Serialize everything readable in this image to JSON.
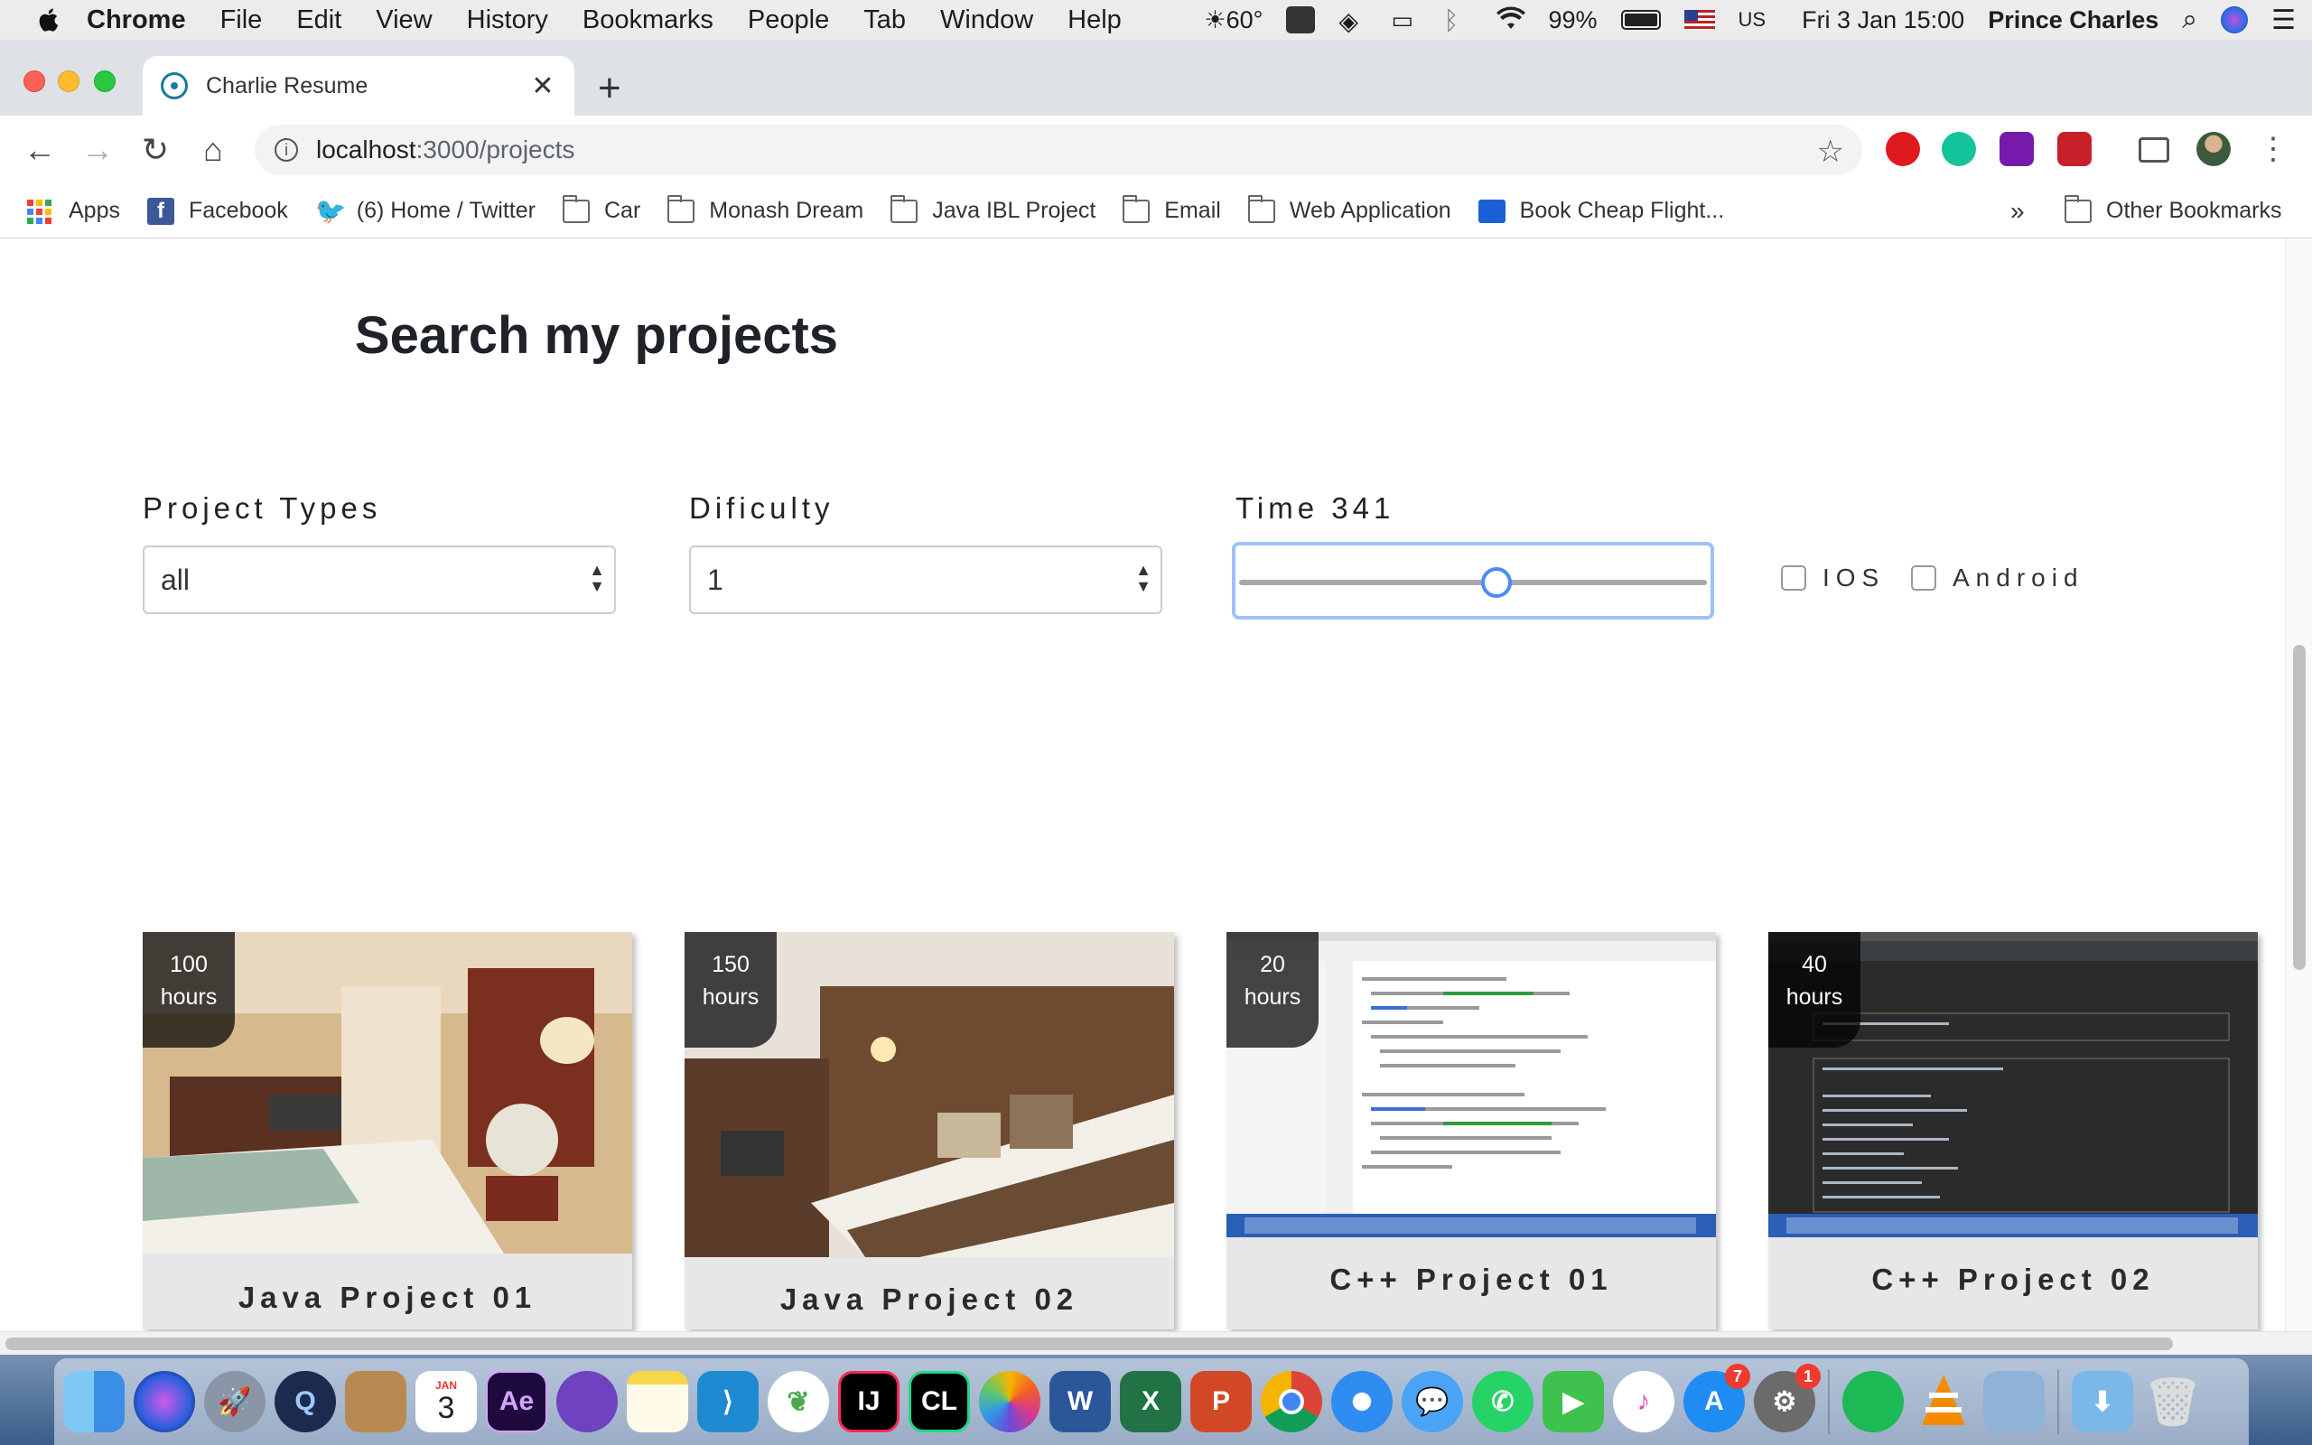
{
  "menubar": {
    "app": "Chrome",
    "items": [
      "File",
      "Edit",
      "View",
      "History",
      "Bookmarks",
      "People",
      "Tab",
      "Window",
      "Help"
    ],
    "temperature": "60°",
    "battery": "99%",
    "input_source": "US",
    "datetime": "Fri 3 Jan  15:00",
    "user": "Prince Charles"
  },
  "browser": {
    "tab_title": "Charlie Resume",
    "tab_close": "✕",
    "new_tab": "+",
    "url_host": "localhost",
    "url_path": ":3000/projects",
    "bookmarks": [
      {
        "label": "Apps",
        "icon": "apps-grid-icon"
      },
      {
        "label": "Facebook",
        "icon": "facebook-icon"
      },
      {
        "label": "(6) Home / Twitter",
        "icon": "twitter-icon"
      },
      {
        "label": "Car",
        "icon": "folder-icon"
      },
      {
        "label": "Monash Dream",
        "icon": "folder-icon"
      },
      {
        "label": "Java IBL Project",
        "icon": "folder-icon"
      },
      {
        "label": "Email",
        "icon": "folder-icon"
      },
      {
        "label": "Web Application",
        "icon": "folder-icon"
      },
      {
        "label": "Book Cheap Flight...",
        "icon": "flight-icon"
      }
    ],
    "bookmarks_overflow": "»",
    "other_bookmarks": "Other Bookmarks"
  },
  "page": {
    "heading": "Search my projects",
    "filters": {
      "project_types_label": "Project Types",
      "project_types_value": "all",
      "difficulty_label": "Dificulty",
      "difficulty_value": "1",
      "time_label": "Time 341",
      "time_slider_fraction": 0.55,
      "ios_label": "IOS",
      "android_label": "Android"
    },
    "projects": [
      {
        "hours_value": "100",
        "hours_unit": "hours",
        "title": "Java Project 01",
        "thumb": "hotel-room-photo"
      },
      {
        "hours_value": "150",
        "hours_unit": "hours",
        "title": "Java Project 02",
        "thumb": "hotel-room-photo"
      },
      {
        "hours_value": "20",
        "hours_unit": "hours",
        "title": "C++ Project 01",
        "thumb": "ide-screenshot-light"
      },
      {
        "hours_value": "40",
        "hours_unit": "hours",
        "title": "C++ Project 02",
        "thumb": "ide-screenshot-dark"
      }
    ]
  },
  "dock": {
    "calendar_month": "JAN",
    "calendar_day": "3",
    "app_store_badge": "7",
    "system_prefs_badge": "1",
    "apps": [
      "Finder",
      "Siri",
      "Launchpad",
      "QuickTime Player",
      "Contacts",
      "Calendar",
      "Adobe After Effects",
      "GitHub Desktop",
      "Notes",
      "Visual Studio Code",
      "MongoDB Compass",
      "IntelliJ IDEA",
      "CLion",
      "Photos",
      "Microsoft Word",
      "Microsoft Excel",
      "Microsoft PowerPoint",
      "Google Chrome",
      "Safari",
      "Messages",
      "WhatsApp",
      "FaceTime",
      "iTunes",
      "App Store",
      "System Preferences",
      "Spotify",
      "VLC",
      "Preview",
      "Downloads",
      "Trash"
    ]
  },
  "colors": {
    "menubar": "#ececec",
    "tabstrip": "#dee1e6",
    "slider_focus": "#9dc1f5",
    "slider_thumb": "#4a8cf0",
    "card_footer": "#e7e7e7"
  }
}
